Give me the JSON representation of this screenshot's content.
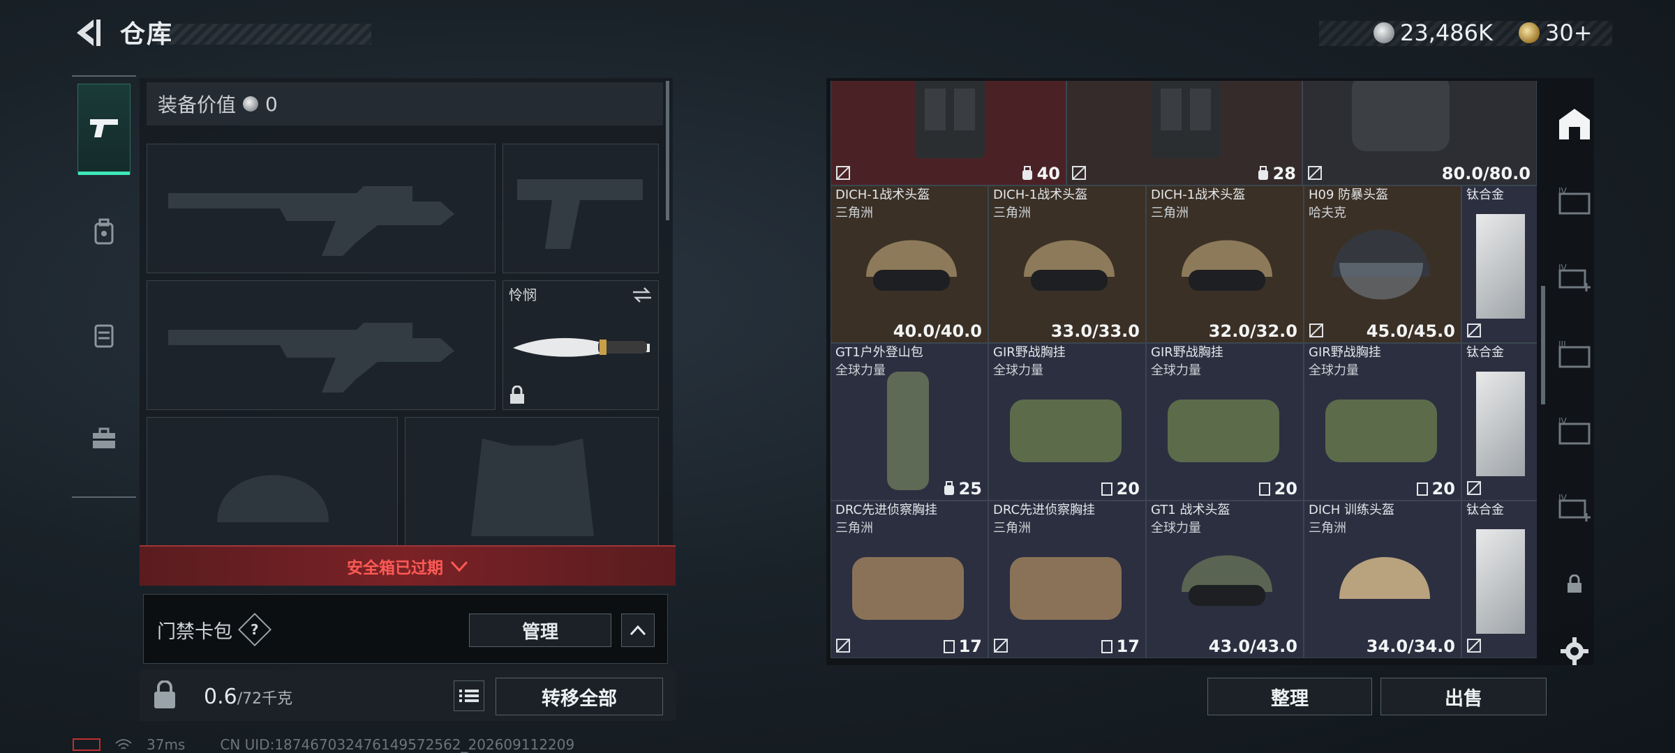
{
  "header": {
    "title": "仓库",
    "currency_silver": "23,486K",
    "currency_gold": "30+"
  },
  "equipment": {
    "value_label": "装备价值",
    "value_amount": "0",
    "melee_name": "怜悯",
    "safebox_text": "安全箱已过期",
    "keycard_label": "门禁卡包",
    "help_glyph": "?",
    "manage_label": "管理",
    "weight_current": "0.6",
    "weight_max": "/72千克",
    "transfer_label": "转移全部"
  },
  "status": {
    "ping": "37ms",
    "uid": "CN UID:187467032476149572562_202609112209"
  },
  "storage": {
    "top_row": [
      {
        "value": "40",
        "has_icon": true
      },
      {
        "value": "28",
        "has_icon": true
      },
      {
        "value": "80.0/80.0",
        "has_icon": false
      }
    ],
    "rows": [
      [
        {
          "name": "DICH-1战术头盔",
          "region": "三角洲",
          "value": "40.0/40.0",
          "kind": "helmet-tan"
        },
        {
          "name": "DICH-1战术头盔",
          "region": "三角洲",
          "value": "33.0/33.0",
          "kind": "helmet-tan"
        },
        {
          "name": "DICH-1战术头盔",
          "region": "三角洲",
          "value": "32.0/32.0",
          "kind": "helmet-tan"
        },
        {
          "name": "H09 防暴头盔",
          "region": "哈夫克",
          "value": "45.0/45.0",
          "kind": "helmet-riot"
        },
        {
          "name": "钛合金",
          "region": "",
          "value": "",
          "kind": "plate"
        }
      ],
      [
        {
          "name": "GT1户外登山包",
          "region": "全球力量",
          "value": "25",
          "kind": "backpack"
        },
        {
          "name": "GIR野战胸挂",
          "region": "全球力量",
          "value": "20",
          "kind": "rig-green"
        },
        {
          "name": "GIR野战胸挂",
          "region": "全球力量",
          "value": "20",
          "kind": "rig-green"
        },
        {
          "name": "GIR野战胸挂",
          "region": "全球力量",
          "value": "20",
          "kind": "rig-green"
        },
        {
          "name": "钛合金",
          "region": "",
          "value": "",
          "kind": "plate"
        }
      ],
      [
        {
          "name": "DRC先进侦察胸挂",
          "region": "三角洲",
          "value": "17",
          "kind": "rig-brown"
        },
        {
          "name": "DRC先进侦察胸挂",
          "region": "三角洲",
          "value": "17",
          "kind": "rig-brown"
        },
        {
          "name": "GT1 战术头盔",
          "region": "全球力量",
          "value": "43.0/43.0",
          "kind": "helmet-green"
        },
        {
          "name": "DICH 训练头盔",
          "region": "三角洲",
          "value": "34.0/34.0",
          "kind": "helmet-camo"
        },
        {
          "name": "钛合金",
          "region": "",
          "value": "",
          "kind": "plate"
        }
      ]
    ],
    "sort_label": "整理",
    "sell_label": "出售"
  },
  "colors": {
    "accent": "#3ee6b8",
    "danger": "#ff5a55",
    "cell_brown": "#3b3026",
    "cell_blue": "#2b2f40"
  }
}
